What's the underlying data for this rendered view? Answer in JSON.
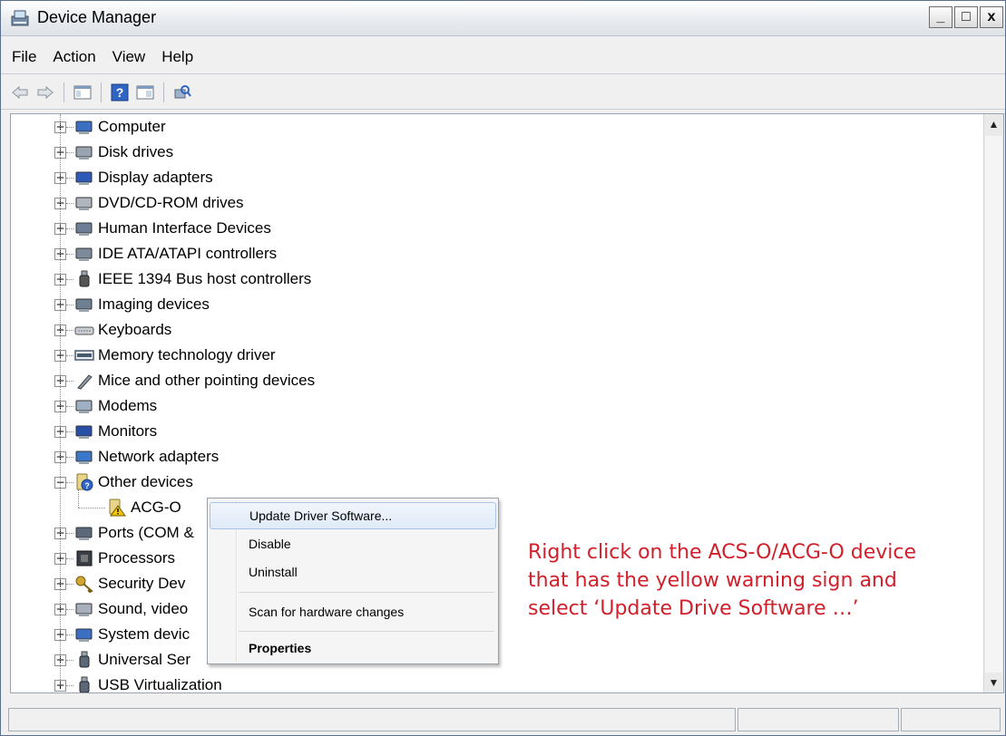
{
  "window": {
    "title": "Device Manager"
  },
  "title_buttons": [
    "_",
    "□",
    "x"
  ],
  "menu": [
    {
      "label": "File"
    },
    {
      "label": "Action"
    },
    {
      "label": "View"
    },
    {
      "label": "Help"
    }
  ],
  "toolbar": {
    "icons": [
      "back-arrow-icon",
      "forward-arrow-icon",
      "show-hide-console-tree-icon",
      "help-icon",
      "properties-pane-icon",
      "scan-hardware-icon"
    ]
  },
  "tree": {
    "items": [
      {
        "label": "Computer",
        "icon": "computer-icon",
        "expander": "+"
      },
      {
        "label": "Disk drives",
        "icon": "disk-drive-icon",
        "expander": "+"
      },
      {
        "label": "Display adapters",
        "icon": "display-adapter-icon",
        "expander": "+"
      },
      {
        "label": "DVD/CD-ROM drives",
        "icon": "dvd-drive-icon",
        "expander": "+"
      },
      {
        "label": "Human Interface Devices",
        "icon": "hid-icon",
        "expander": "+"
      },
      {
        "label": "IDE ATA/ATAPI controllers",
        "icon": "ide-controller-icon",
        "expander": "+"
      },
      {
        "label": "IEEE 1394 Bus host controllers",
        "icon": "ieee1394-icon",
        "expander": "+"
      },
      {
        "label": "Imaging devices",
        "icon": "camera-icon",
        "expander": "+"
      },
      {
        "label": "Keyboards",
        "icon": "keyboard-icon",
        "expander": "+"
      },
      {
        "label": "Memory technology driver",
        "icon": "memory-icon",
        "expander": "+"
      },
      {
        "label": "Mice and other pointing devices",
        "icon": "mouse-icon",
        "expander": "+"
      },
      {
        "label": "Modems",
        "icon": "modem-icon",
        "expander": "+"
      },
      {
        "label": "Monitors",
        "icon": "monitor-icon",
        "expander": "+"
      },
      {
        "label": "Network adapters",
        "icon": "network-adapter-icon",
        "expander": "+"
      },
      {
        "label": "Other devices",
        "icon": "unknown-device-icon",
        "expander": "−"
      },
      {
        "label": "ACG-O",
        "icon": "warning-device-icon",
        "expander": ""
      },
      {
        "label": "Ports (COM &",
        "icon": "port-icon",
        "expander": "+"
      },
      {
        "label": "Processors",
        "icon": "processor-icon",
        "expander": "+"
      },
      {
        "label": "Security Dev",
        "icon": "security-key-icon",
        "expander": "+"
      },
      {
        "label": "Sound, video",
        "icon": "sound-icon",
        "expander": "+"
      },
      {
        "label": "System devic",
        "icon": "system-device-icon",
        "expander": "+"
      },
      {
        "label": "Universal Ser",
        "icon": "usb-icon",
        "expander": "+"
      },
      {
        "label": "USB Virtualization",
        "icon": "usb-icon",
        "expander": "+"
      }
    ]
  },
  "context_menu": {
    "items": [
      {
        "label": "Update Driver Software...",
        "highlighted": true
      },
      {
        "label": "Disable"
      },
      {
        "label": "Uninstall"
      },
      {
        "label": "Scan for hardware changes"
      },
      {
        "label": "Properties",
        "bold": true
      }
    ]
  },
  "annotation": {
    "lines": [
      "Right click on the ACS-O/ACG-O device",
      "that has the yellow warning sign and",
      "select ‘Update Drive Software …’"
    ]
  },
  "colors": {
    "annotation": "#d1202b",
    "highlight": "#dfeaf8",
    "warning": "#f2c400"
  }
}
